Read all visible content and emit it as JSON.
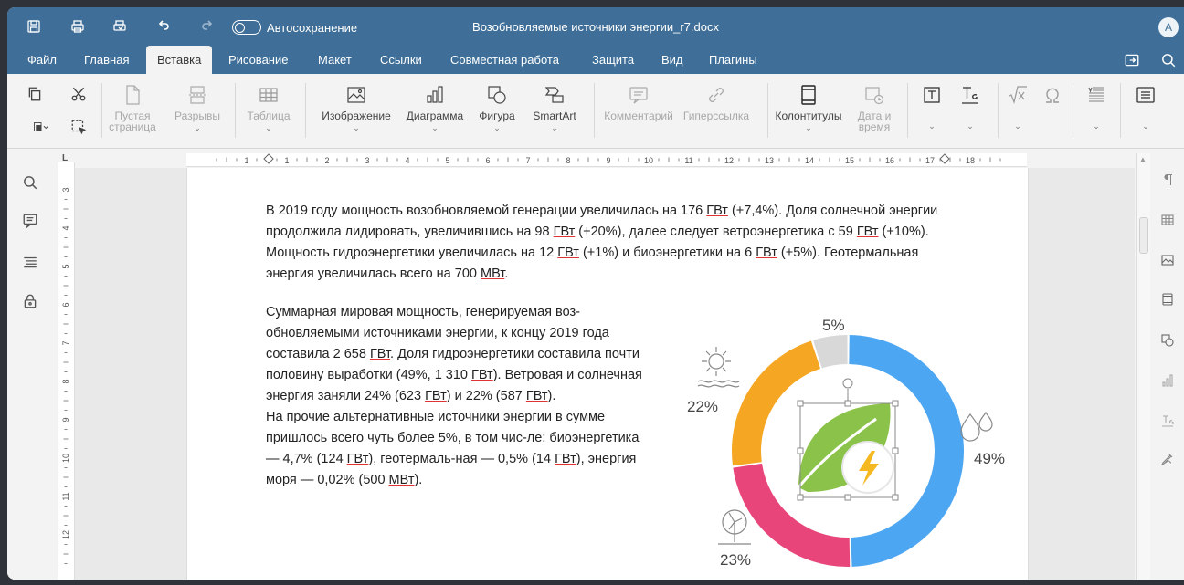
{
  "titlebar": {
    "autosave_label": "Автосохранение",
    "document_title": "Возобновляемые источники энергии_r7.docx",
    "avatar_initial": "A"
  },
  "menu": {
    "items": [
      "Файл",
      "Главная",
      "Вставка",
      "Рисование",
      "Макет",
      "Ссылки",
      "Совместная работа",
      "Защита",
      "Вид",
      "Плагины"
    ],
    "active": "Вставка"
  },
  "toolbar": {
    "blank_page": "Пустая страница",
    "breaks": "Разрывы",
    "table": "Таблица",
    "image": "Изображение",
    "chart": "Диаграмма",
    "shape": "Фигура",
    "smartart": "SmartArt",
    "comment": "Комментарий",
    "hyperlink": "Гиперссылка",
    "header_footer": "Колонтитулы",
    "date_time": "Дата и время"
  },
  "document": {
    "para1": [
      "В 2019 году мощность возобновляемой генерации увеличилась на 176 ",
      "ГВт",
      " (+7,4%). Доля солнечной энергии продолжила лидировать, увеличившись на 98 ",
      "ГВт",
      " (+20%), далее следует ветроэнергетика с 59 ",
      "ГВт",
      " (+10%). Мощность гидроэнергетики увеличилась на 12 ",
      "ГВт",
      " (+1%) и биоэнергетики на 6 ",
      "ГВт",
      " (+5%). Геотермальная энергия увеличилась всего на 700 ",
      "МВт",
      "."
    ],
    "para2": [
      "Суммарная мировая мощность, генерируемая воз-обновляемыми источниками энергии, к концу 2019 года составила 2 658 ",
      "ГВт",
      ".  Доля гидроэнергетики составила почти половину выработки (49%, 1 310 ",
      "ГВт",
      "). Ветровая и солнечная энергия заняли 24% (623 ",
      "ГВт",
      ") и 22% (587 ",
      "ГВт",
      ")."
    ],
    "para3": [
      "На прочие альтернативные источники энергии в сумме пришлось всего чуть более 5%, в том чис-ле: биоэнергетика — 4,7% (124 ",
      "ГВт",
      "), геотермаль-ная — 0,5% (14 ",
      "ГВт",
      "), энергия моря — 0,02% (500 ",
      "МВт",
      ")."
    ]
  },
  "ruler": {
    "h_labels": [
      "1",
      "1",
      "2",
      "3",
      "4",
      "5",
      "6",
      "7",
      "8",
      "9",
      "10",
      "11",
      "12",
      "13",
      "14",
      "15",
      "16",
      "17",
      "18"
    ],
    "v_labels": [
      "3",
      "4",
      "5",
      "6",
      "7",
      "8",
      "9",
      "10",
      "11",
      "12"
    ]
  },
  "chart_data": {
    "type": "pie",
    "labels": [
      "49%",
      "23%",
      "22%",
      "5%"
    ],
    "values": [
      49,
      23,
      22,
      5
    ],
    "colors": [
      "#4ca6f2",
      "#e8457a",
      "#f5a623",
      "#d8d8d8"
    ],
    "title": "",
    "icons": [
      "water-drops-icon",
      "wind-turbine-icon",
      "sun-icon",
      "leaf-bolt-icon"
    ]
  }
}
